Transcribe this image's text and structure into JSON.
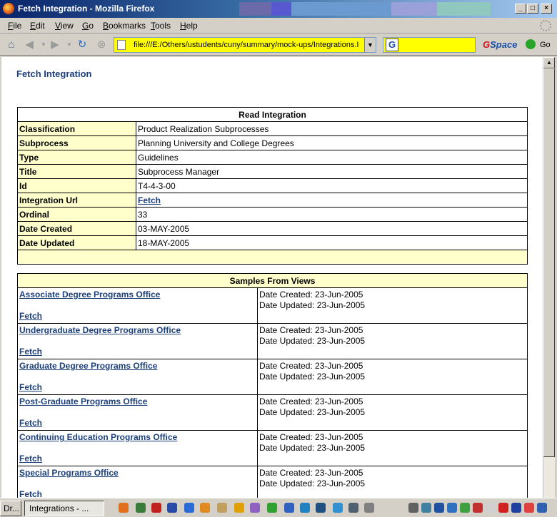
{
  "window": {
    "title": "Fetch Integration - Mozilla Firefox"
  },
  "menu": [
    "File",
    "Edit",
    "View",
    "Go",
    "Bookmarks",
    "Tools",
    "Help"
  ],
  "toolbar": {
    "url": "file:///E:/Others/ustudents/cuny/summary/mock-ups/Integrations.I",
    "search_engine_icon": "G",
    "gspace_g": "G",
    "gspace_rest": "Space",
    "go_label": "Go"
  },
  "page": {
    "title": "Fetch Integration",
    "read": {
      "header": "Read Integration",
      "rows": [
        {
          "label": "Classification",
          "value": "Product Realization Subprocesses"
        },
        {
          "label": "Subprocess",
          "value": "Planning University and College Degrees"
        },
        {
          "label": "Type",
          "value": "Guidelines"
        },
        {
          "label": "Title",
          "value": "Subprocess Manager"
        },
        {
          "label": "Id",
          "value": "T4-4-3-00"
        },
        {
          "label": "Integration Url",
          "value": "Fetch"
        },
        {
          "label": "Ordinal",
          "value": "33"
        },
        {
          "label": "Date Created",
          "value": "03-MAY-2005"
        },
        {
          "label": "Date Updated",
          "value": "18-MAY-2005"
        }
      ]
    },
    "samples": {
      "header": "Samples From Views",
      "items": [
        {
          "name": "Associate Degree Programs Office",
          "fetch": "Fetch",
          "created": "Date Created: 23-Jun-2005",
          "updated": "Date Updated: 23-Jun-2005"
        },
        {
          "name": "Undergraduate Degree Programs Office",
          "fetch": "Fetch",
          "created": "Date Created: 23-Jun-2005",
          "updated": "Date Updated: 23-Jun-2005"
        },
        {
          "name": "Graduate Degree Programs Office",
          "fetch": "Fetch",
          "created": "Date Created: 23-Jun-2005",
          "updated": "Date Updated: 23-Jun-2005"
        },
        {
          "name": "Post-Graduate Programs Office",
          "fetch": "Fetch",
          "created": "Date Created: 23-Jun-2005",
          "updated": "Date Updated: 23-Jun-2005"
        },
        {
          "name": "Continuing Education Programs Office",
          "fetch": "Fetch",
          "created": "Date Created: 23-Jun-2005",
          "updated": "Date Updated: 23-Jun-2005"
        },
        {
          "name": "Special Programs Office",
          "fetch": "Fetch",
          "created": "Date Created: 23-Jun-2005",
          "updated": "Date Updated: 23-Jun-2005"
        }
      ]
    }
  },
  "taskbar": {
    "task_partial": "Dr...",
    "task_active": "Integrations - ..."
  }
}
